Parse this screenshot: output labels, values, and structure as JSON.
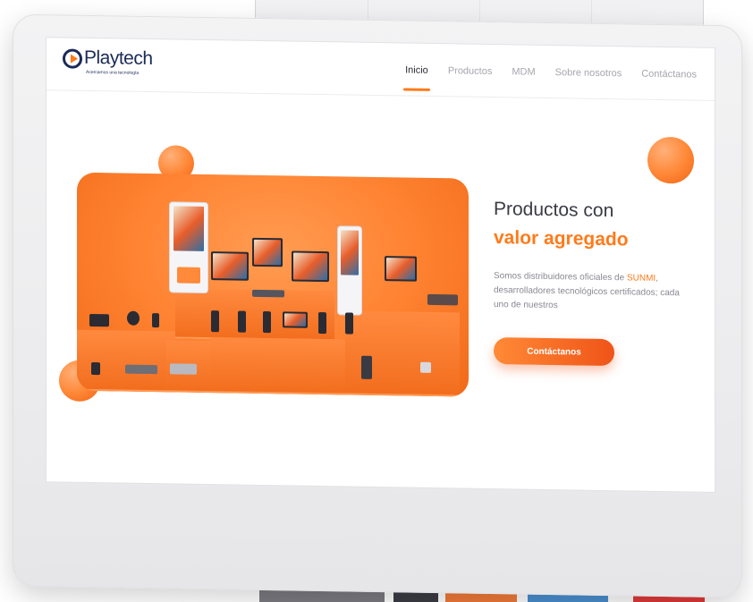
{
  "brand": {
    "name": "Playtech",
    "tagline": "Acercamos una tecnología",
    "accent_color": "#ff7a1a",
    "dark_color": "#1b2a57"
  },
  "nav": {
    "items": [
      {
        "label": "Inicio",
        "active": true
      },
      {
        "label": "Productos",
        "active": false
      },
      {
        "label": "MDM",
        "active": false
      },
      {
        "label": "Sobre nosotros",
        "active": false
      },
      {
        "label": "Contáctanos",
        "active": false
      }
    ]
  },
  "hero": {
    "title": "Productos con",
    "title_accent": "valor agregado",
    "body_before": "Somos distribuidores oficiales de ",
    "body_brand": "SUNMI",
    "body_after": ", desarrolladores tecnológicos certificados; cada uno de nuestros",
    "cta_label": "Contáctanos",
    "image_icon": "pos-devices-showcase"
  }
}
